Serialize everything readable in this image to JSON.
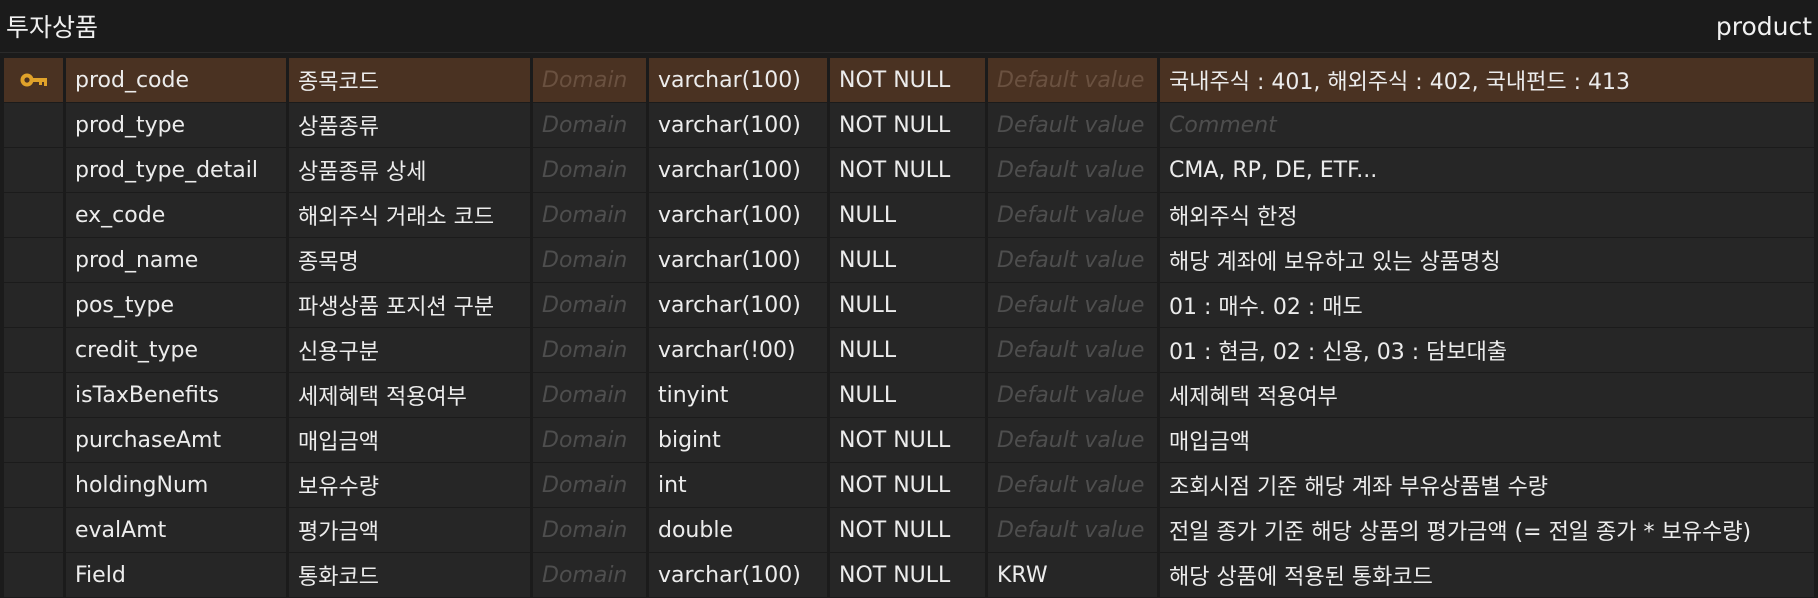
{
  "header": {
    "title": "투자상품",
    "table_name": "product"
  },
  "placeholders": {
    "domain": "Domain",
    "default": "Default value",
    "comment": "Comment"
  },
  "colors": {
    "key_icon": "#e0a22a",
    "selected_row": "#4a3222",
    "row": "#262626",
    "placeholder": "#4e4e4e"
  },
  "rows": [
    {
      "key": true,
      "field": "prod_code",
      "logical": "종목코드",
      "domain": "",
      "type": "varchar(100)",
      "null": "NOT NULL",
      "default": "",
      "comment": "국내주식 : 401, 해외주식 : 402, 국내펀드 : 413"
    },
    {
      "key": false,
      "field": "prod_type",
      "logical": "상품종류",
      "domain": "",
      "type": "varchar(100)",
      "null": "NOT NULL",
      "default": "",
      "comment": ""
    },
    {
      "key": false,
      "field": "prod_type_detail",
      "logical": "상품종류 상세",
      "domain": "",
      "type": "varchar(100)",
      "null": "NOT NULL",
      "default": "",
      "comment": "CMA, RP, DE, ETF..."
    },
    {
      "key": false,
      "field": "ex_code",
      "logical": "해외주식 거래소 코드",
      "domain": "",
      "type": "varchar(100)",
      "null": "NULL",
      "default": "",
      "comment": "해외주식 한정"
    },
    {
      "key": false,
      "field": "prod_name",
      "logical": "종목명",
      "domain": "",
      "type": "varchar(100)",
      "null": "NULL",
      "default": "",
      "comment": "해당 계좌에 보유하고 있는 상품명칭"
    },
    {
      "key": false,
      "field": "pos_type",
      "logical": "파생상품 포지션 구분",
      "domain": "",
      "type": "varchar(100)",
      "null": "NULL",
      "default": "",
      "comment": "01 : 매수. 02 : 매도"
    },
    {
      "key": false,
      "field": "credit_type",
      "logical": "신용구분",
      "domain": "",
      "type": "varchar(!00)",
      "null": "NULL",
      "default": "",
      "comment": "01 : 현금, 02 : 신용, 03 : 담보대출"
    },
    {
      "key": false,
      "field": "isTaxBenefits",
      "logical": "세제혜택 적용여부",
      "domain": "",
      "type": "tinyint",
      "null": "NULL",
      "default": "",
      "comment": "세제혜택 적용여부"
    },
    {
      "key": false,
      "field": "purchaseAmt",
      "logical": "매입금액",
      "domain": "",
      "type": "bigint",
      "null": "NOT NULL",
      "default": "",
      "comment": "매입금액"
    },
    {
      "key": false,
      "field": "holdingNum",
      "logical": "보유수량",
      "domain": "",
      "type": "int",
      "null": "NOT NULL",
      "default": "",
      "comment": "조회시점 기준 해당 계좌 부유상품별 수량"
    },
    {
      "key": false,
      "field": "evalAmt",
      "logical": "평가금액",
      "domain": "",
      "type": "double",
      "null": "NOT NULL",
      "default": "",
      "comment": "전일 종가 기준 해당 상품의 평가금액 (= 전일 종가 * 보유수량)"
    },
    {
      "key": false,
      "field": "Field",
      "logical": "통화코드",
      "domain": "",
      "type": "varchar(100)",
      "null": "NOT NULL",
      "default": "KRW",
      "comment": "해당 상품에 적용된 통화코드"
    }
  ]
}
